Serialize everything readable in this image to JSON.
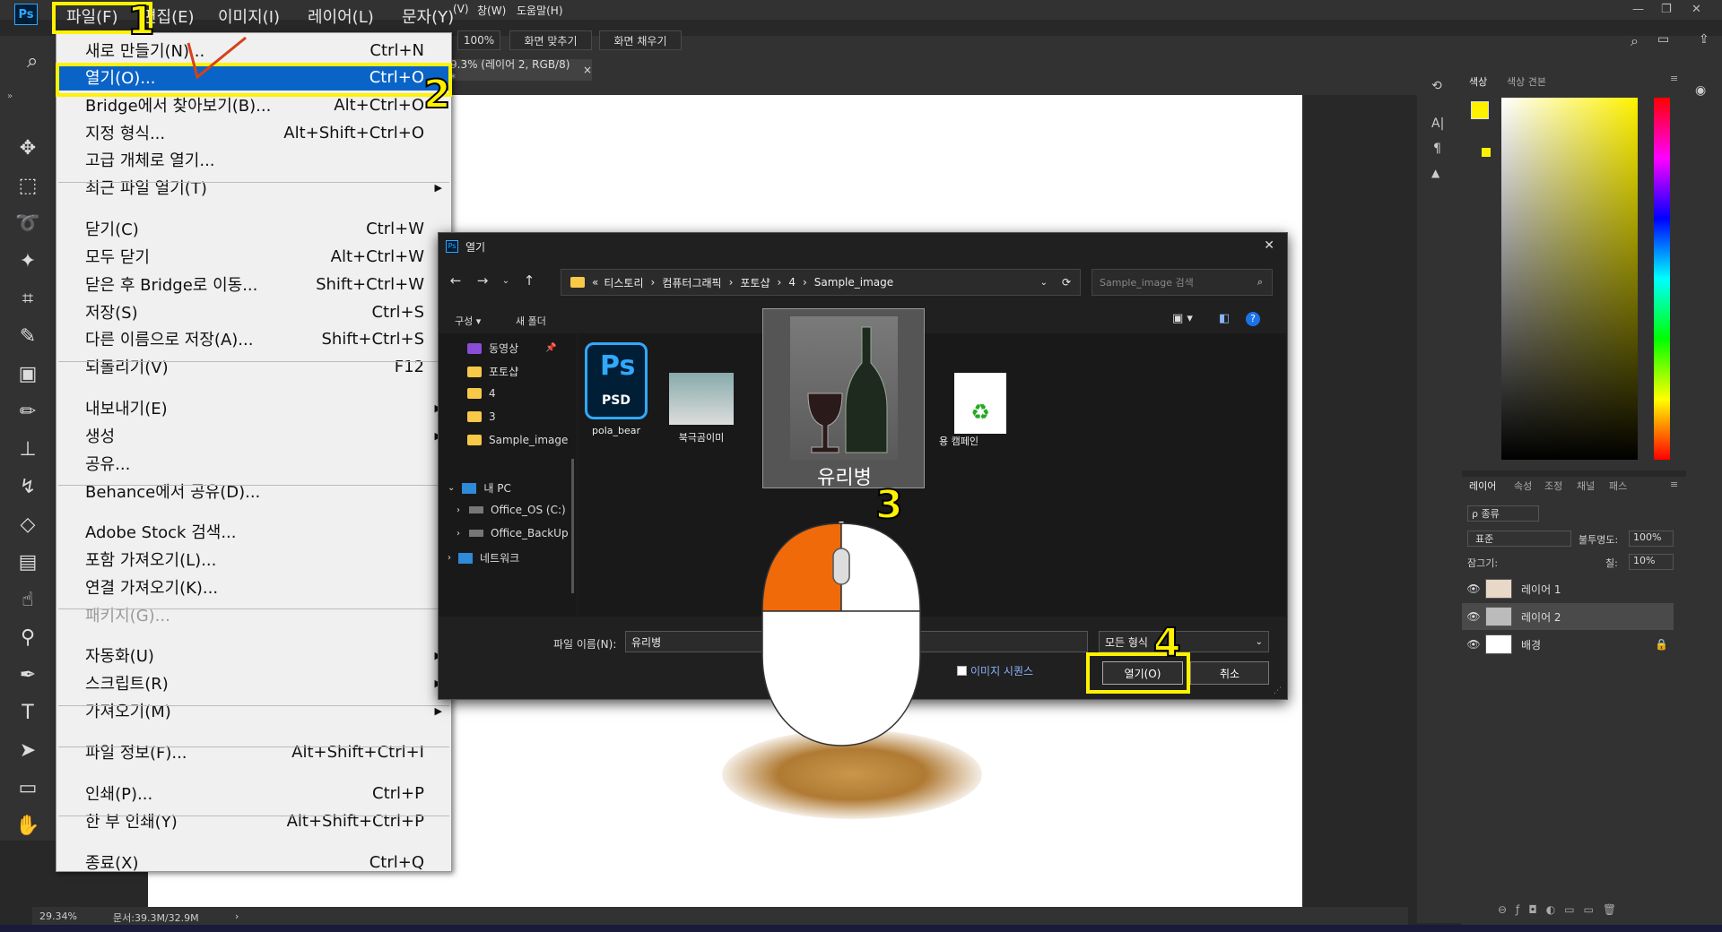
{
  "app": {
    "logo": "Ps"
  },
  "menubar": {
    "items": [
      "파일(F)",
      "편집(E)",
      "이미지(I)",
      "레이어(L)",
      "문자(Y)"
    ],
    "small_items": [
      "(V)",
      "창(W)",
      "도움말(H)"
    ]
  },
  "options": {
    "zoom": "100%",
    "fit": "화면 맞추기",
    "fill": "화면 채우기"
  },
  "doc_tab": {
    "label": "9.3% (레이어 2, RGB/8) *",
    "close": "×"
  },
  "file_menu": {
    "items": [
      {
        "label": "새로 만들기(N)...",
        "shortcut": "Ctrl+N"
      },
      {
        "label": "열기(O)...",
        "shortcut": "Ctrl+O"
      },
      {
        "label": "Bridge에서 찾아보기(B)...",
        "shortcut": "Alt+Ctrl+O"
      },
      {
        "label": "지정 형식...",
        "shortcut": "Alt+Shift+Ctrl+O"
      },
      {
        "label": "고급 개체로 열기...",
        "shortcut": ""
      },
      {
        "label": "최근 파일 열기(T)",
        "shortcut": ""
      },
      {
        "label": "닫기(C)",
        "shortcut": "Ctrl+W"
      },
      {
        "label": "모두 닫기",
        "shortcut": "Alt+Ctrl+W"
      },
      {
        "label": "닫은 후 Bridge로 이동...",
        "shortcut": "Shift+Ctrl+W"
      },
      {
        "label": "저장(S)",
        "shortcut": "Ctrl+S"
      },
      {
        "label": "다른 이름으로 저장(A)...",
        "shortcut": "Shift+Ctrl+S"
      },
      {
        "label": "되돌리기(V)",
        "shortcut": "F12"
      },
      {
        "label": "내보내기(E)",
        "shortcut": ""
      },
      {
        "label": "생성",
        "shortcut": ""
      },
      {
        "label": "공유...",
        "shortcut": ""
      },
      {
        "label": "Behance에서 공유(D)...",
        "shortcut": ""
      },
      {
        "label": "Adobe Stock 검색...",
        "shortcut": ""
      },
      {
        "label": "포함 가져오기(L)...",
        "shortcut": ""
      },
      {
        "label": "연결 가져오기(K)...",
        "shortcut": ""
      },
      {
        "label": "패키지(G)...",
        "shortcut": ""
      },
      {
        "label": "자동화(U)",
        "shortcut": ""
      },
      {
        "label": "스크립트(R)",
        "shortcut": ""
      },
      {
        "label": "가져오기(M)",
        "shortcut": ""
      },
      {
        "label": "파일 정보(F)...",
        "shortcut": "Alt+Shift+Ctrl+I"
      },
      {
        "label": "인쇄(P)...",
        "shortcut": "Ctrl+P"
      },
      {
        "label": "한 부 인쇄(Y)",
        "shortcut": "Alt+Shift+Ctrl+P"
      },
      {
        "label": "종료(X)",
        "shortcut": "Ctrl+Q"
      }
    ],
    "submenu_arrow": "▶"
  },
  "callouts": [
    "1",
    "2",
    "3",
    "4"
  ],
  "dialog": {
    "title": "열기",
    "close": "✕",
    "address": [
      "«",
      "티스토리",
      "컴퓨터그래픽",
      "포토샵",
      "4",
      "Sample_image"
    ],
    "search_placeholder": "Sample_image 검색",
    "organize": "구성 ▾",
    "new_folder": "새 폴더",
    "nav": [
      {
        "label": "동영상",
        "kind": "video"
      },
      {
        "label": "포토샵",
        "kind": "folder"
      },
      {
        "label": "4",
        "kind": "folder"
      },
      {
        "label": "3",
        "kind": "folder"
      },
      {
        "label": "Sample_image",
        "kind": "folder"
      },
      {
        "label": "내 PC",
        "kind": "pc"
      },
      {
        "label": "Office_OS (C:)",
        "kind": "drive"
      },
      {
        "label": "Office_BackUp",
        "kind": "drive"
      },
      {
        "label": "네트워크",
        "kind": "network"
      }
    ],
    "files": [
      {
        "label": "pola_bear",
        "kind": "psd"
      },
      {
        "label": "북극곰이미",
        "kind": "image"
      },
      {
        "label": "용 캠페인",
        "kind": "image"
      }
    ],
    "psd_text": "Ps",
    "psd_sub": "PSD",
    "filename_label": "파일 이름(N):",
    "filename_value": "유리병",
    "filetype": "모든 형식",
    "preview_checkbox": "이미지 시퀀스",
    "open_button": "열기(O)",
    "cancel_button": "취소"
  },
  "drag_preview": {
    "label": "유리병"
  },
  "status": {
    "zoom": "29.34%",
    "doc": "문서:39.3M/32.9M"
  },
  "panels": {
    "color_tabs": [
      "색상",
      "색상 견본"
    ],
    "layer_tabs": [
      "레이어",
      "속성",
      "조정",
      "채널",
      "패스"
    ],
    "kind_filter": "ρ 종류",
    "blend_mode": "표준",
    "opacity_label": "불투명도:",
    "opacity_value": "100%",
    "lock_label": "잠그기:",
    "fill_label": "칠:",
    "fill_value": "10%",
    "layers": [
      "레이어 1",
      "레이어 2",
      "배경"
    ]
  },
  "colors": {
    "accent": "#0a64c8",
    "highlight": "#fff200",
    "mouse_orange": "#f06a0a"
  }
}
